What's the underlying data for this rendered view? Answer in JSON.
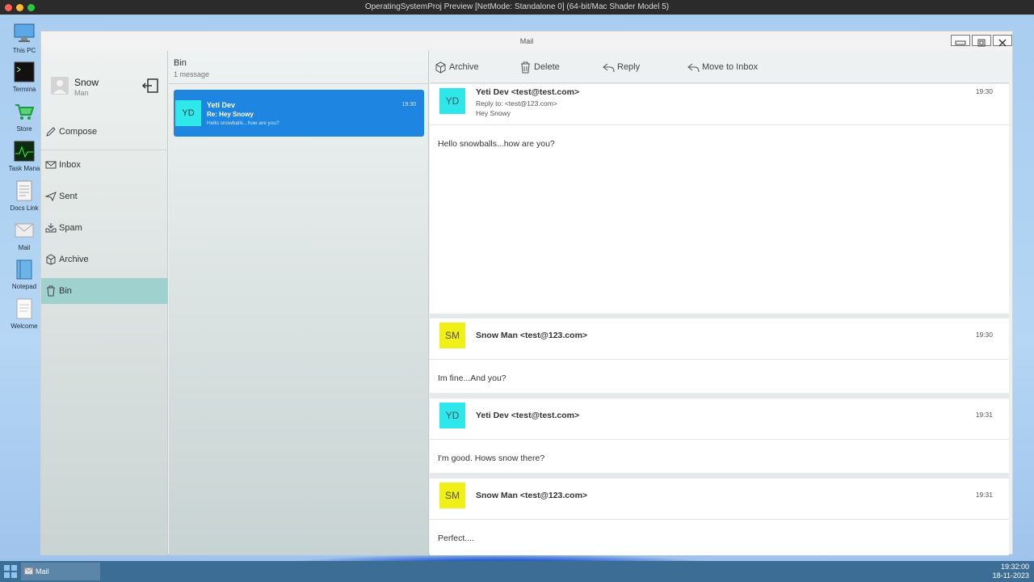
{
  "host": {
    "title": "OperatingSystemProj Preview [NetMode: Standalone 0]  (64-bit/Mac Shader Model 5)"
  },
  "desktop_icons": [
    {
      "label": "This PC"
    },
    {
      "label": "Termina"
    },
    {
      "label": "Store"
    },
    {
      "label": "Task Mana"
    },
    {
      "label": "Docs Link"
    },
    {
      "label": "Mail"
    },
    {
      "label": "Notepad"
    },
    {
      "label": "Welcome"
    }
  ],
  "taskbar": {
    "item_label": "Mail",
    "time": "19:32:00",
    "date": "18-11-2023"
  },
  "window": {
    "title": "Mail"
  },
  "user": {
    "name": "Snow",
    "subtitle": "Man"
  },
  "nav": {
    "compose": "Compose",
    "inbox": "Inbox",
    "sent": "Sent",
    "spam": "Spam",
    "archive": "Archive",
    "bin": "Bin"
  },
  "list": {
    "title": "Bin",
    "count": "1 message",
    "card": {
      "initials": "YD",
      "from": "Yeti Dev",
      "subject": "Re: Hey Snowy",
      "preview": "Hello snowballs...how are you?",
      "time": "19:30"
    }
  },
  "toolbar": {
    "archive": "Archive",
    "delete": "Delete",
    "reply": "Reply",
    "move_to_inbox": "Move to Inbox"
  },
  "thread": [
    {
      "initials": "YD",
      "from": "Yeti Dev <test@test.com>",
      "reply_to": "Reply to: <test@123.com>",
      "subject": "Hey Snowy",
      "time": "19:30",
      "body": "Hello snowballs...how are you?",
      "avatar_color": "#2de7ea"
    },
    {
      "initials": "SM",
      "from": "Snow Man <test@123.com>",
      "time": "19:30",
      "body": "Im fine...And you?",
      "avatar_color": "#f0f018"
    },
    {
      "initials": "YD",
      "from": "Yeti Dev <test@test.com>",
      "time": "19:31",
      "body": "I'm good. Hows snow there?",
      "avatar_color": "#2de7ea"
    },
    {
      "initials": "SM",
      "from": "Snow Man <test@123.com>",
      "time": "19:31",
      "body": "Perfect....",
      "avatar_color": "#f0f018"
    }
  ],
  "colors": {
    "accent": "#1e86e0",
    "active_nav": "#9fd1cf",
    "taskbar": "#3c6e95"
  }
}
